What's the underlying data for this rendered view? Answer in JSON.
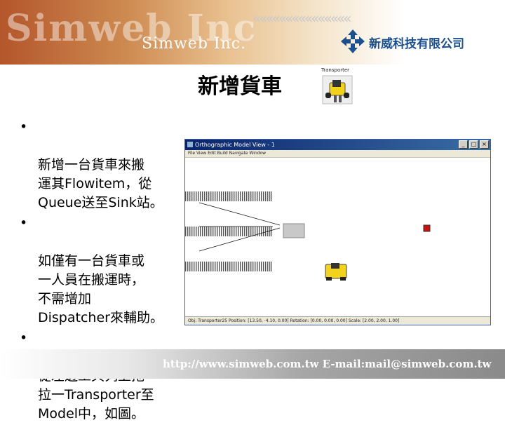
{
  "header": {
    "watermark_text": "Simweb Inc",
    "brand_text": "Simweb Inc.",
    "arrows_text": "«««««««««««««««",
    "company_name": "新威科技有限公司",
    "logo_icon": "cross-arrows-logo-icon",
    "accent_color": "#1c4f8e"
  },
  "slide": {
    "title": "新增貨車",
    "transporter_caption": "Transporter",
    "bullets": [
      "新增一台貨車來搬\n運其Flowitem，從\nQueue送至Sink站。",
      "如僅有一台貨車或\n一人員在搬運時，\n不需增加\nDispatcher來輔助。",
      "從左邊工具列上拖\n拉一Transporter至\nModel中，如圖。"
    ],
    "bullet_glyph": "•"
  },
  "window": {
    "title": "Orthographic Model View - 1",
    "menu": "File  View  Edit  Build  Navigate  Window",
    "minimize": "_",
    "maximize": "□",
    "close": "×",
    "status": "Obj: Transporter25 Position: [13.50, -4.10, 0.00] Rotation: [0.00, 0.00, 0.00] Scale: [2.00, 2.00, 1.00]"
  },
  "footer": {
    "text": "http://www.simweb.com.tw   E-mail:mail@simweb.com.tw"
  }
}
